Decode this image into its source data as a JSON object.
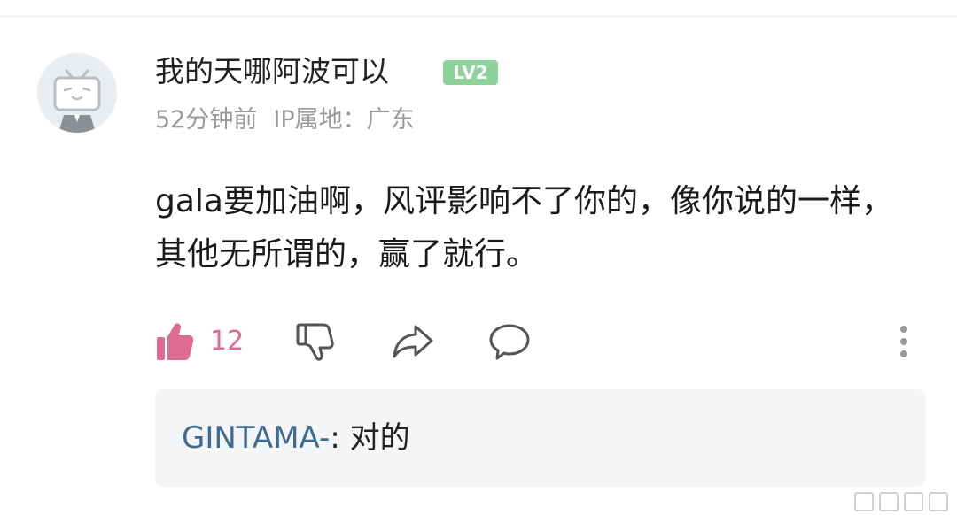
{
  "comment": {
    "username": "我的天哪阿波可以",
    "level": "LV2",
    "time": "52分钟前",
    "ip_location": "IP属地：广东",
    "text": "gala要加油啊，风评影响不了你的，像你说的一样，其他无所谓的，赢了就行。",
    "like_count": "12"
  },
  "reply": {
    "user": "GINTAMA-",
    "separator": ": ",
    "text": "对的"
  },
  "icons": {
    "avatar": "default-tv-avatar",
    "like": "thumbs-up-icon",
    "dislike": "thumbs-down-icon",
    "share": "share-arrow-icon",
    "reply": "speech-bubble-icon",
    "more": "vertical-dots-icon"
  },
  "colors": {
    "accent_pink": "#e06b91",
    "level_green": "#8ed29b",
    "reply_user_blue": "#3e6b92",
    "meta_gray": "#9a9a9a",
    "reply_bg": "#f4f5f7"
  }
}
